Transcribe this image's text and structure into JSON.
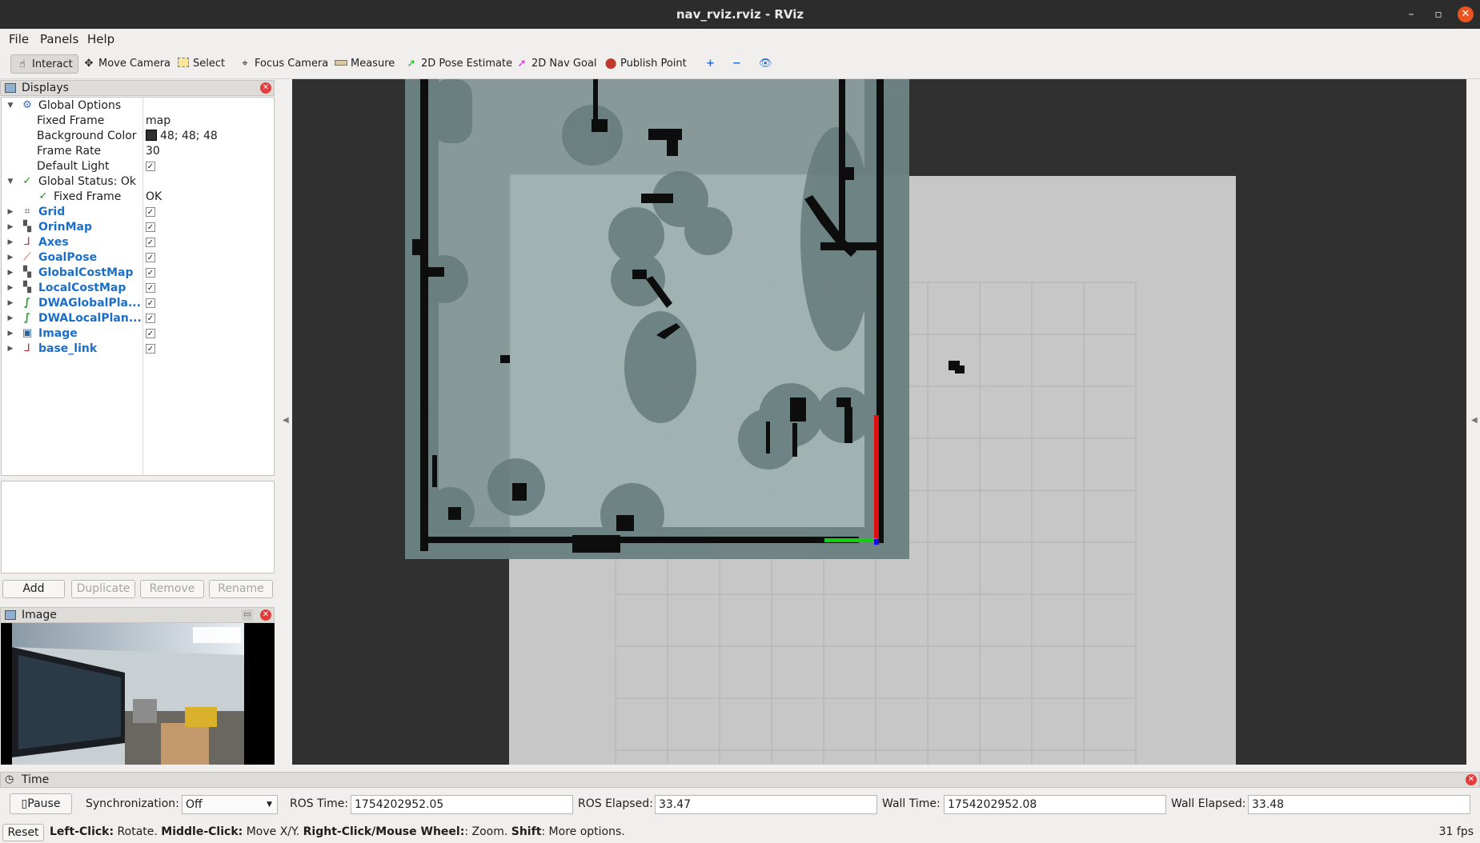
{
  "window": {
    "title": "nav_rviz.rviz - RViz",
    "minimize_glyph": "–",
    "maximize_glyph": "▫",
    "close_glyph": "✕"
  },
  "menubar": {
    "items": [
      "File",
      "Panels",
      "Help"
    ]
  },
  "toolbar": {
    "tools": [
      {
        "label": "Interact",
        "icon": "hand-pointer-icon"
      },
      {
        "label": "Move Camera",
        "icon": "move-camera-icon"
      },
      {
        "label": "Select",
        "icon": "select-box-icon"
      },
      {
        "label": "Focus Camera",
        "icon": "focus-camera-icon"
      },
      {
        "label": "Measure",
        "icon": "ruler-icon"
      },
      {
        "label": "2D Pose Estimate",
        "icon": "pose-estimate-arrow-icon"
      },
      {
        "label": "2D Nav Goal",
        "icon": "nav-goal-arrow-icon"
      },
      {
        "label": "Publish Point",
        "icon": "map-pin-icon"
      }
    ],
    "extra_glyphs": [
      "+",
      "−",
      "👁"
    ]
  },
  "displays_panel": {
    "title": "Displays",
    "global_options": {
      "label": "Global Options",
      "fixed_frame_label": "Fixed Frame",
      "fixed_frame_value": "map",
      "bg_color_label": "Background Color",
      "bg_color_value": "48; 48; 48",
      "bg_color_hex": "#303030",
      "frame_rate_label": "Frame Rate",
      "frame_rate_value": "30",
      "default_light_label": "Default Light",
      "default_light_checked": true
    },
    "global_status": {
      "label": "Global Status: Ok",
      "fixed_frame_label": "Fixed Frame",
      "fixed_frame_value": "OK"
    },
    "displays": [
      {
        "name": "Grid",
        "icon": "grid-icon",
        "checked": true
      },
      {
        "name": "OrinMap",
        "icon": "map-icon",
        "checked": true
      },
      {
        "name": "Axes",
        "icon": "axes-icon",
        "checked": true
      },
      {
        "name": "GoalPose",
        "icon": "pose-arrow-icon",
        "checked": true
      },
      {
        "name": "GlobalCostMap",
        "icon": "map-icon",
        "checked": true
      },
      {
        "name": "LocalCostMap",
        "icon": "map-icon",
        "checked": true
      },
      {
        "name": "DWAGlobalPla...",
        "icon": "path-icon",
        "checked": true
      },
      {
        "name": "DWALocalPlan...",
        "icon": "path-icon",
        "checked": true
      },
      {
        "name": "Image",
        "icon": "image-icon",
        "checked": true
      },
      {
        "name": "base_link",
        "icon": "axes-icon",
        "checked": true
      }
    ],
    "check_glyph": "✓",
    "buttons": [
      {
        "label": "Add",
        "enabled": true
      },
      {
        "label": "Duplicate",
        "enabled": false
      },
      {
        "label": "Remove",
        "enabled": false
      },
      {
        "label": "Rename",
        "enabled": false
      }
    ]
  },
  "image_panel": {
    "title": "Image"
  },
  "time_panel": {
    "title": "Time",
    "pause_label": "Pause",
    "sync_label": "Synchronization:",
    "sync_value": "Off",
    "ros_time_label": "ROS Time:",
    "ros_time_value": "1754202952.05",
    "ros_elapsed_label": "ROS Elapsed:",
    "ros_elapsed_value": "33.47",
    "wall_time_label": "Wall Time:",
    "wall_time_value": "1754202952.08",
    "wall_elapsed_label": "Wall Elapsed:",
    "wall_elapsed_value": "33.48"
  },
  "status_bar": {
    "reset_label": "Reset",
    "hint_left_click": "Left-Click:",
    "hint_left_action": " Rotate. ",
    "hint_middle_click": "Middle-Click:",
    "hint_middle_action": " Move X/Y. ",
    "hint_right_click": "Right-Click/Mouse Wheel:",
    "hint_right_action": ": Zoom. ",
    "hint_shift": "Shift",
    "hint_shift_action": ": More options.",
    "fps": "31 fps"
  },
  "colors": {
    "accent_blue": "#1c6fc8",
    "viewport_bg": "#303030",
    "costmap": "#8fa3a3",
    "axis_x": "#e01010",
    "axis_y": "#10d010",
    "axis_z": "#1010e0"
  }
}
